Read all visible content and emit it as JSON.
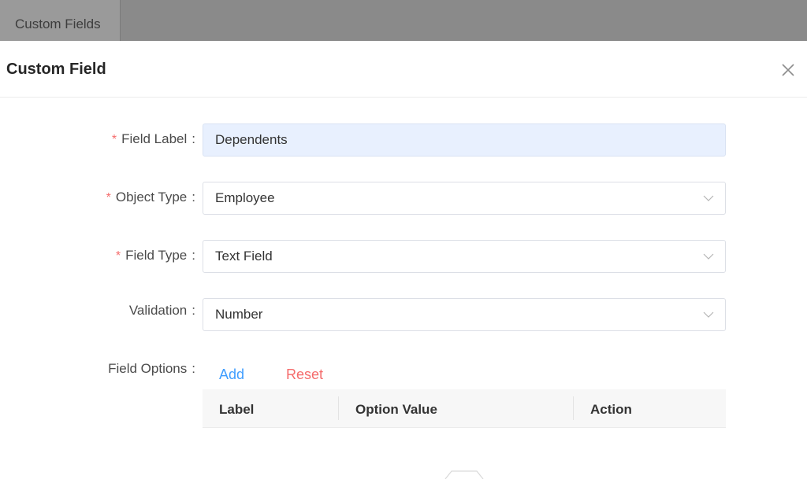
{
  "background_page": {
    "tab_label": "Custom Fields"
  },
  "modal": {
    "title": "Custom Field",
    "close_icon": "close-icon"
  },
  "form": {
    "required_marker": "*",
    "colon": ":",
    "field_label": {
      "label": "Field Label",
      "value": "Dependents"
    },
    "object_type": {
      "label": "Object Type",
      "value": "Employee"
    },
    "field_type": {
      "label": "Field Type",
      "value": "Text Field"
    },
    "validation": {
      "label": "Validation",
      "value": "Number"
    },
    "field_options": {
      "label": "Field Options",
      "add_label": "Add",
      "reset_label": "Reset",
      "columns": [
        "Label",
        "Option Value",
        "Action"
      ]
    }
  },
  "colors": {
    "required": "#f56c6c",
    "link_primary": "#409eff",
    "link_danger": "#f56c6c",
    "filled_input": "#e8f0fe"
  }
}
